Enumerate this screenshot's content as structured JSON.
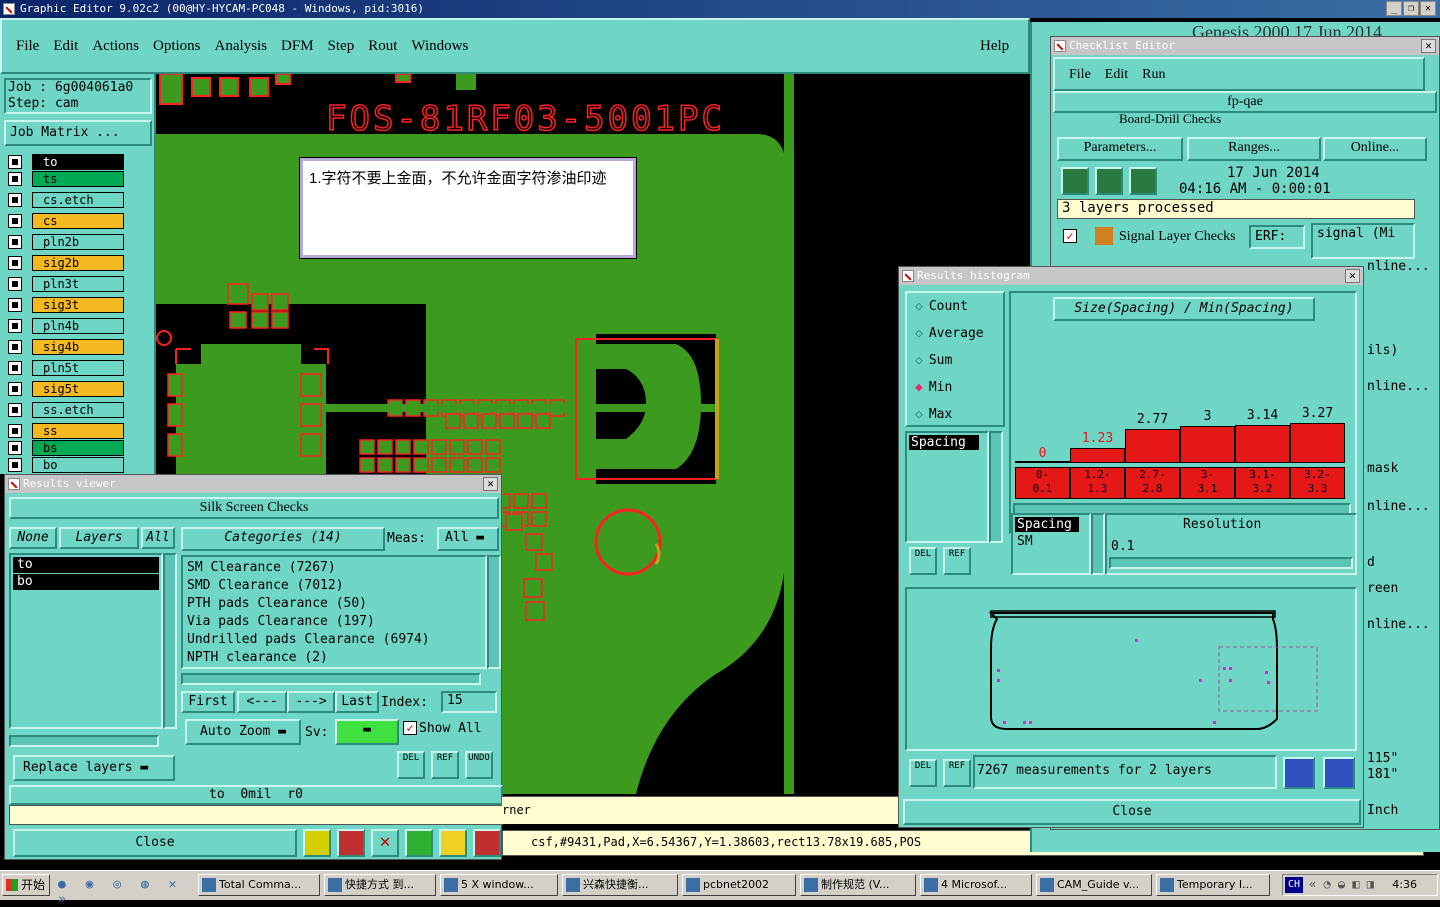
{
  "main_window": {
    "title": "Graphic Editor 9.02c2 (00@HY-HYCAM-PC048 - Windows, pid:3016)",
    "menus": [
      "File",
      "Edit",
      "Actions",
      "Options",
      "Analysis",
      "DFM",
      "Step",
      "Rout",
      "Windows"
    ],
    "help": "Help",
    "job": "Job : 6g004061a0",
    "step": "Step: cam",
    "job_matrix": "Job Matrix ...",
    "status_line": "csf,#9431,Pad,X=6.54367,Y=1.38603,rect13.78x19.685,POS",
    "corner_text": "rner"
  },
  "layers": [
    {
      "name": "to",
      "style": "blk"
    },
    {
      "name": "ts",
      "style": "grn"
    },
    {
      "name": "cs.etch",
      "style": ""
    },
    {
      "name": "cs",
      "style": "org"
    },
    {
      "name": "pln2b",
      "style": ""
    },
    {
      "name": "sig2b",
      "style": "org"
    },
    {
      "name": "pln3t",
      "style": ""
    },
    {
      "name": "sig3t",
      "style": "org"
    },
    {
      "name": "pln4b",
      "style": ""
    },
    {
      "name": "sig4b",
      "style": "org"
    },
    {
      "name": "pln5t",
      "style": ""
    },
    {
      "name": "sig5t",
      "style": "org"
    },
    {
      "name": "ss.etch",
      "style": ""
    },
    {
      "name": "ss",
      "style": "org"
    },
    {
      "name": "bs",
      "style": "grn"
    },
    {
      "name": "bo",
      "style": ""
    }
  ],
  "canvas": {
    "board_text": "FOS-81RF03-5001PC",
    "note": "1.字符不要上金面，不允许金面字符渗油印迹"
  },
  "results_viewer": {
    "title": "Results viewer",
    "heading": "Silk Screen Checks",
    "none_btn": "None",
    "layers_btn": "Layers",
    "all_btn": "All",
    "layer_items": [
      "to",
      "bo"
    ],
    "categories_btn": "Categories (14)",
    "meas_label": "Meas:",
    "meas_value": "All",
    "categories": [
      "SM Clearance (7267)",
      "SMD Clearance (7012)",
      "PTH pads Clearance (50)",
      "Via pads Clearance (197)",
      "Undrilled pads Clearance (6974)",
      "NPTH clearance (2)"
    ],
    "first": "First",
    "prev": "<---",
    "next": "--->",
    "last": "Last",
    "index_label": "Index:",
    "index_value": "15",
    "auto_zoom": "Auto Zoom",
    "sv_label": "Sv:",
    "show_all": "Show All",
    "replace_layers": "Replace layers",
    "del": "DEL",
    "ref": "REF",
    "undo": "UNDO",
    "status": "to  0mil  r0",
    "close": "Close"
  },
  "checklist_editor": {
    "back_title": "Genesis 2000 17 Jun 2014",
    "title": "Checklist Editor",
    "menus": [
      "File",
      "Edit",
      "Run"
    ],
    "checklist_name": "fp-qae",
    "board_drill": "Board-Drill Checks",
    "erf": "ERF:",
    "parameters": "Parameters...",
    "ranges": "Ranges...",
    "online": "Online...",
    "date": "17 Jun 2014",
    "time": "04:16 AM - 0:00:01",
    "processed": "3 layers processed",
    "signal_checks": "Signal Layer Checks",
    "signal_field": "signal (Mi",
    "side_texts": [
      "nline...",
      "ils)",
      "nline...",
      "mask",
      "nline...",
      "d",
      "reen",
      "nline...",
      "115\"",
      "181\"",
      "Inch"
    ]
  },
  "histogram": {
    "title": "Results histogram",
    "options": [
      "Count",
      "Average",
      "Sum",
      "Min",
      "Max"
    ],
    "selected": "Min",
    "chart_title": "Size(Spacing) / Min(Spacing)",
    "list_selected": "Spacing",
    "list2": [
      "Spacing",
      "SM"
    ],
    "resolution_label": "Resolution",
    "resolution_value": "0.1",
    "summary": "7267 measurements for 2 layers",
    "del": "DEL",
    "ref": "REF",
    "close": "Close"
  },
  "chart_data": {
    "type": "bar",
    "title": "Size(Spacing) / Min(Spacing)",
    "categories": [
      "0-\n0.1",
      "1.2-\n1.3",
      "2.7-\n2.8",
      "3-\n3.1",
      "3.1-\n3.2",
      "3.2-\n3.3"
    ],
    "values": [
      0,
      1.23,
      2.77,
      3,
      3.14,
      3.27
    ],
    "value_labels": [
      "0",
      "1.23",
      "2.77",
      "3",
      "3.14",
      "3.27"
    ],
    "colors": {
      "bar": "#e51818"
    }
  },
  "taskbar": {
    "start": "开始",
    "items": [
      "Total Comma...",
      "快捷方式 到...",
      "5 X window...",
      "兴森快捷衡...",
      "pcbnet2002",
      "制作规范 (V...",
      "4 Microsof...",
      "CAM_Guide v...",
      "Temporary I..."
    ],
    "lang": "CH",
    "clock": "4:36"
  },
  "colors": {
    "teal": "#6fd6c6",
    "copper": "#3c9a1e",
    "silk": "#ff2020"
  }
}
